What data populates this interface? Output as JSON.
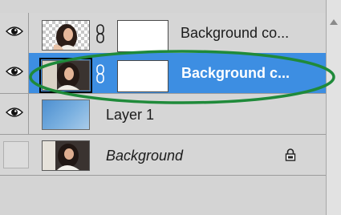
{
  "layers": [
    {
      "name": "Background co...",
      "visible": true,
      "thumbnail": "portrait-photo-on-transparency",
      "has_mask": true,
      "selected": false,
      "italic": false,
      "locked": false
    },
    {
      "name": "Background c...",
      "visible": true,
      "thumbnail": "portrait-photo",
      "has_mask": true,
      "selected": true,
      "italic": false,
      "locked": false
    },
    {
      "name": "Layer 1",
      "visible": true,
      "thumbnail": "blue-gradient-fill",
      "has_mask": false,
      "selected": false,
      "italic": false,
      "locked": false
    },
    {
      "name": "Background",
      "visible": false,
      "thumbnail": "portrait-photo",
      "has_mask": false,
      "selected": false,
      "italic": true,
      "locked": true
    }
  ],
  "colors": {
    "selection": "#3d8ee2",
    "callout_ring": "#1f8a3a",
    "panel": "#d6d6d6"
  },
  "icons": {
    "visibility": "eye-icon",
    "link": "chain-link-icon",
    "lock": "lock-icon",
    "scroll": "scroll-up-arrow-icon"
  }
}
